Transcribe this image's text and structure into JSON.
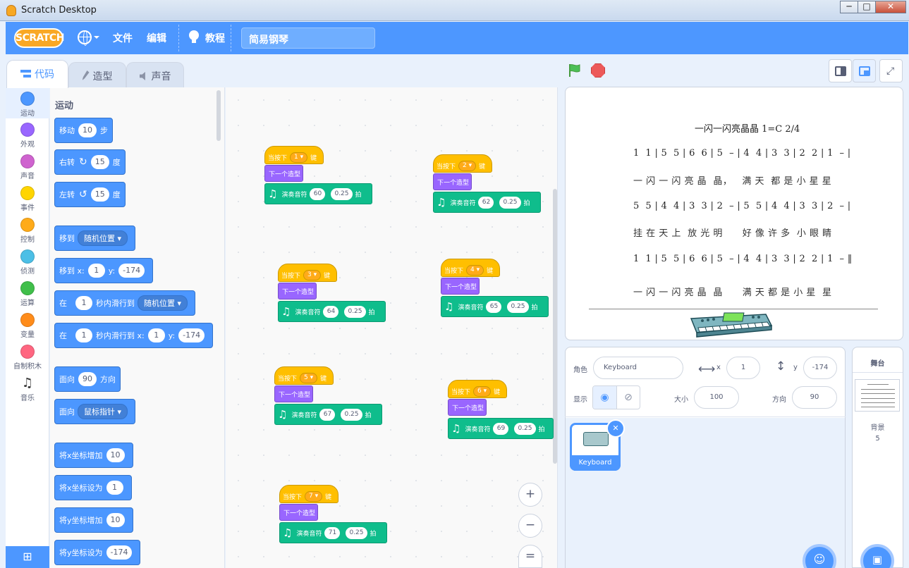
{
  "window": {
    "title": "Scratch Desktop",
    "minimize": "─",
    "maximize": "□",
    "close": "✕"
  },
  "menubar": {
    "logo": "SCRATCH",
    "file": "文件",
    "edit": "编辑",
    "tutorials": "教程",
    "project_title": "简易钢琴"
  },
  "tabs": {
    "code": "代码",
    "costumes": "造型",
    "sounds": "声音"
  },
  "categories": [
    {
      "label": "运动",
      "color": "#4c97ff"
    },
    {
      "label": "外观",
      "color": "#9966ff"
    },
    {
      "label": "声音",
      "color": "#cf63cf"
    },
    {
      "label": "事件",
      "color": "#ffd500"
    },
    {
      "label": "控制",
      "color": "#ffab19"
    },
    {
      "label": "侦测",
      "color": "#4cbfe6"
    },
    {
      "label": "运算",
      "color": "#40bf4a"
    },
    {
      "label": "变量",
      "color": "#ff8c1a"
    },
    {
      "label": "自制积木",
      "color": "#ff6680"
    },
    {
      "label": "音乐",
      "color": "#0fbd8c"
    }
  ],
  "palette": {
    "heading": "运动",
    "move": {
      "a": "移动",
      "v": "10",
      "b": "步"
    },
    "turn_right": {
      "a": "右转",
      "v": "15",
      "b": "度"
    },
    "turn_left": {
      "a": "左转",
      "v": "15",
      "b": "度"
    },
    "goto": {
      "a": "移到",
      "drop": "随机位置"
    },
    "goto_xy": {
      "a": "移到 x:",
      "x": "1",
      "b": "y:",
      "y": "-174"
    },
    "glide": {
      "a": "在",
      "v": "1",
      "b": "秒内滑行到",
      "drop": "随机位置"
    },
    "glide_xy": {
      "a": "在",
      "v": "1",
      "b": "秒内滑行到 x:",
      "x": "1",
      "c": "y:",
      "y": "-174"
    },
    "point_dir": {
      "a": "面向",
      "v": "90",
      "b": "方向"
    },
    "point_towards": {
      "a": "面向",
      "drop": "鼠标指针"
    },
    "change_x": {
      "a": "将x坐标增加",
      "v": "10"
    },
    "set_x": {
      "a": "将x坐标设为",
      "v": "1"
    },
    "change_y": {
      "a": "将y坐标增加",
      "v": "10"
    },
    "set_y": {
      "a": "将y坐标设为",
      "v": "-174"
    }
  },
  "scripts": {
    "when_key": "当按下",
    "key_suffix": "键",
    "next_costume": "下一个造型",
    "play_note": "演奏音符",
    "beats": "拍",
    "items": [
      {
        "key": "1",
        "note": "60",
        "beat": "0.25"
      },
      {
        "key": "2",
        "note": "62",
        "beat": "0.25"
      },
      {
        "key": "3",
        "note": "64",
        "beat": "0.25"
      },
      {
        "key": "4",
        "note": "65",
        "beat": "0.25"
      },
      {
        "key": "5",
        "note": "67",
        "beat": "0.25"
      },
      {
        "key": "6",
        "note": "69",
        "beat": "0.25"
      },
      {
        "key": "7",
        "note": "71",
        "beat": "0.25"
      }
    ]
  },
  "zoom": {
    "in": "+",
    "out": "−",
    "reset": "="
  },
  "stage": {
    "title": "一闪一闪亮晶晶   1=C 2/4",
    "line1": "1  1 | 5  5 | 6  6 | 5  – | 4  4 | 3  3 | 2  2 | 1  – |",
    "lyric1": "一 闪 一 闪 亮 晶  晶，   满 天  都 是 小 星 星",
    "line2": "5  5 | 4  4 | 3  3 | 2  – | 5  5 | 4  4 | 3  3 | 2  – |",
    "lyric2": "挂 在 天 上  放 光 明      好 像 许 多  小 眼 睛",
    "line3": "1  1 | 5  5 | 6  6 | 5  – | 4  4 | 3  3 | 2  2 | 1  – ‖",
    "lyric3": "一 闪 一 闪 亮 晶  晶      满 天 都 是 小 星  星"
  },
  "sprite_info": {
    "sprite_label": "角色",
    "sprite_name": "Keyboard",
    "x_label": "x",
    "x": "1",
    "y_label": "y",
    "y": "-174",
    "show_label": "显示",
    "size_label": "大小",
    "size": "100",
    "direction_label": "方向",
    "direction": "90"
  },
  "sprites": [
    {
      "name": "Keyboard"
    }
  ],
  "stage_pane": {
    "title": "舞台",
    "backdrops_label": "背景",
    "backdrops_count": "5"
  },
  "colors": {
    "accent": "#4d97ff",
    "events": "#ffbf00",
    "looks": "#9966ff",
    "music": "#0fbd8c"
  }
}
